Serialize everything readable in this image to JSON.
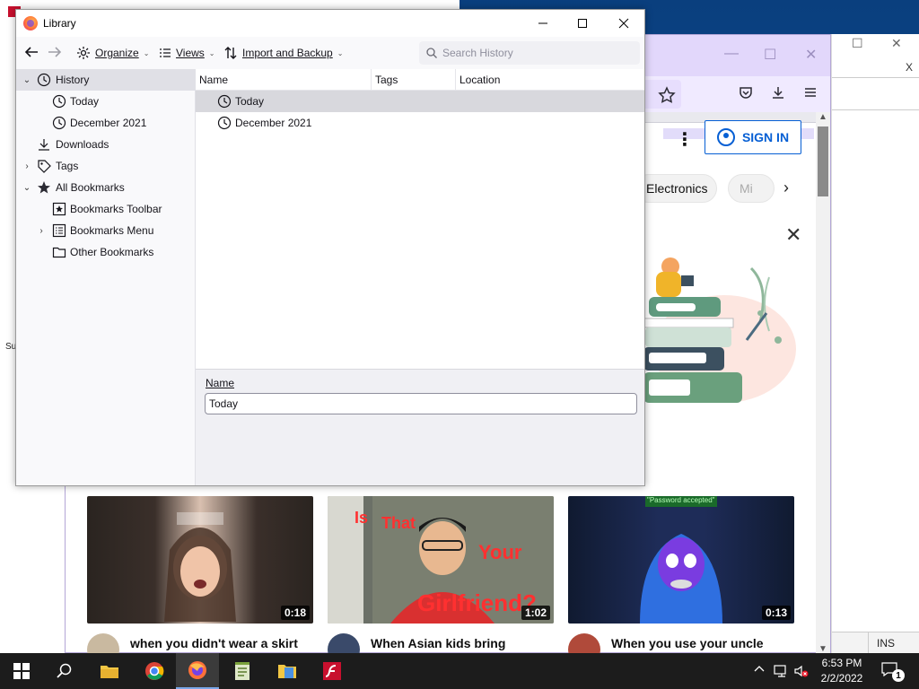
{
  "library": {
    "title": "Library",
    "toolbar": {
      "organize": "Organize",
      "views": "Views",
      "import_backup": "Import and Backup",
      "search_placeholder": "Search History"
    },
    "sidebar": {
      "items": [
        {
          "label": "History"
        },
        {
          "label": "Today"
        },
        {
          "label": "December 2021"
        },
        {
          "label": "Downloads"
        },
        {
          "label": "Tags"
        },
        {
          "label": "All Bookmarks"
        },
        {
          "label": "Bookmarks Toolbar"
        },
        {
          "label": "Bookmarks Menu"
        },
        {
          "label": "Other Bookmarks"
        }
      ]
    },
    "columns": [
      "Name",
      "Tags",
      "Location"
    ],
    "rows": [
      {
        "name": "Today"
      },
      {
        "name": "December 2021"
      }
    ],
    "details": {
      "name_label": "Name",
      "name_value": "Today"
    }
  },
  "browser": {
    "sign_in": "SIGN IN",
    "chips": [
      "Electronics",
      "Mi"
    ],
    "videos": [
      {
        "title": "when you didn't wear a skirt",
        "duration": "0:18"
      },
      {
        "title": "When Asian kids bring",
        "duration": "1:02"
      },
      {
        "title": "When you use your uncle",
        "duration": "0:13"
      }
    ],
    "video_overlay_words": [
      "Is",
      "That",
      "Your",
      "Girlfriend?"
    ],
    "video_banner": "\"Password accepted\""
  },
  "back_window": {
    "side_text": "Su",
    "x_letter": "X",
    "status_ins": "INS"
  },
  "taskbar": {
    "time": "6:53 PM",
    "date": "2/2/2022",
    "notification_count": "1"
  },
  "colors": {
    "accent_blue": "#065fd4",
    "browser_titlebar": "#e2d7fb",
    "taskbar": "#1c1c1c"
  }
}
